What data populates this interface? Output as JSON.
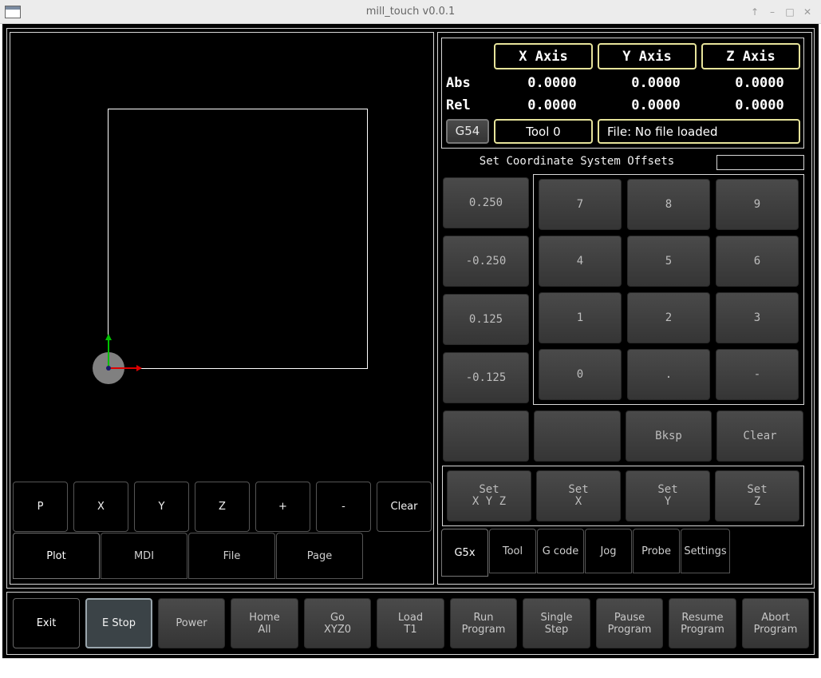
{
  "window": {
    "title": "mill_touch v0.0.1"
  },
  "dro": {
    "axes": [
      "X Axis",
      "Y Axis",
      "Z Axis"
    ],
    "rows": [
      {
        "label": "Abs",
        "values": [
          "0.0000",
          "0.0000",
          "0.0000"
        ]
      },
      {
        "label": "Rel",
        "values": [
          "0.0000",
          "0.0000",
          "0.0000"
        ]
      }
    ],
    "coord_system": "G54",
    "tool": "Tool 0",
    "file": "File: No file loaded"
  },
  "offsets": {
    "title": "Set Coordinate System Offsets",
    "entry_value": "",
    "presets": [
      "0.250",
      "-0.250",
      "0.125",
      "-0.125"
    ],
    "keypad": [
      "7",
      "8",
      "9",
      "4",
      "5",
      "6",
      "1",
      "2",
      "3",
      "0",
      ".",
      "-"
    ],
    "edit_buttons": [
      "",
      "",
      "Bksp",
      "Clear"
    ],
    "set_buttons": [
      "Set\nX Y Z",
      "Set\nX",
      "Set\nY",
      "Set\nZ"
    ]
  },
  "right_tabs": [
    "G5x",
    "Tool",
    "G code",
    "Jog",
    "Probe",
    "Settings"
  ],
  "plot_controls": [
    "P",
    "X",
    "Y",
    "Z",
    "+",
    "-",
    "Clear"
  ],
  "left_tabs": [
    "Plot",
    "MDI",
    "File",
    "Page"
  ],
  "machine_buttons": [
    "Exit",
    "E Stop",
    "Power",
    "Home\nAll",
    "Go\nXYZ0",
    "Load\nT1",
    "Run\nProgram",
    "Single\nStep",
    "Pause\nProgram",
    "Resume\nProgram",
    "Abort\nProgram"
  ],
  "colors": {
    "dro_border": "#e6e39a",
    "x_axis": "#dd0000",
    "y_axis": "#00c000"
  }
}
